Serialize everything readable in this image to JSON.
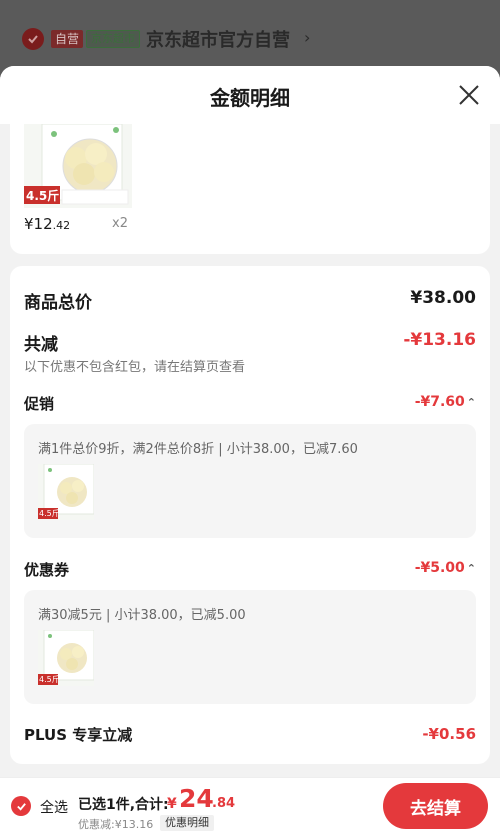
{
  "background": {
    "badge_ziying": "自营",
    "badge_supermarket": "京东超市",
    "shop_name": "京东超市官方自营",
    "arrow": "›"
  },
  "panel": {
    "title": "金额明细"
  },
  "product": {
    "weight_tag": "4.5斤",
    "price_symbol": "¥",
    "price_int": "12",
    "price_dec": ".42",
    "qty": "x2"
  },
  "summary": {
    "total_label": "商品总价",
    "total_value": "¥38.00",
    "reduce_label": "共减",
    "reduce_value": "-¥13.16",
    "reduce_note": "以下优惠不包含红包，请在结算页查看",
    "promo": {
      "label": "促销",
      "value": "-¥7.60",
      "detail": "满1件总价9折，满2件总价8折 | 小计38.00，已减7.60",
      "weight_tag": "4.5斤"
    },
    "coupon": {
      "label": "优惠券",
      "value": "-¥5.00",
      "detail": "满30减5元 | 小计38.00，已减5.00",
      "weight_tag": "4.5斤"
    },
    "plus": {
      "label": "PLUS 专享立减",
      "value": "-¥0.56"
    }
  },
  "bottom": {
    "select_all": "全选",
    "selected_info": "已选1件,合计:",
    "currency": "¥",
    "total_int": "24",
    "total_dec": ".84",
    "discount_line": "优惠减:¥13.16",
    "detail_button": "优惠明细",
    "checkout_button": "去结算"
  },
  "colors": {
    "accent": "#e4393c",
    "panel_bg": "#f2f2f2"
  }
}
